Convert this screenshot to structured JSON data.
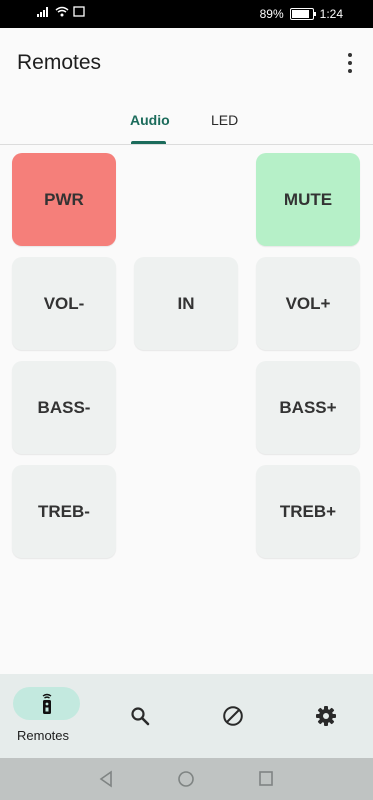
{
  "status_bar": {
    "battery": "89%",
    "time": "1:24"
  },
  "app_bar": {
    "title": "Remotes"
  },
  "tabs": [
    {
      "label": "Audio",
      "selected": true
    },
    {
      "label": "LED",
      "selected": false
    }
  ],
  "buttons": {
    "pwr": "PWR",
    "mute": "MUTE",
    "vol_down": "VOL-",
    "input": "IN",
    "vol_up": "VOL+",
    "bass_down": "BASS-",
    "bass_up": "BASS+",
    "treb_down": "TREB-",
    "treb_up": "TREB+"
  },
  "bottom_nav": {
    "items": [
      {
        "label": "Remotes",
        "icon": "remote-icon",
        "selected": true
      },
      {
        "icon": "search-icon"
      },
      {
        "icon": "block-icon"
      },
      {
        "icon": "settings-gear-icon"
      }
    ]
  },
  "colors": {
    "accent": "#1b6b5b",
    "power": "#f57f7a",
    "mute": "#b6f0c8",
    "button_bg": "#eef1f0",
    "nav_bg": "#e6eceb",
    "nav_selected": "#c3e9df"
  }
}
